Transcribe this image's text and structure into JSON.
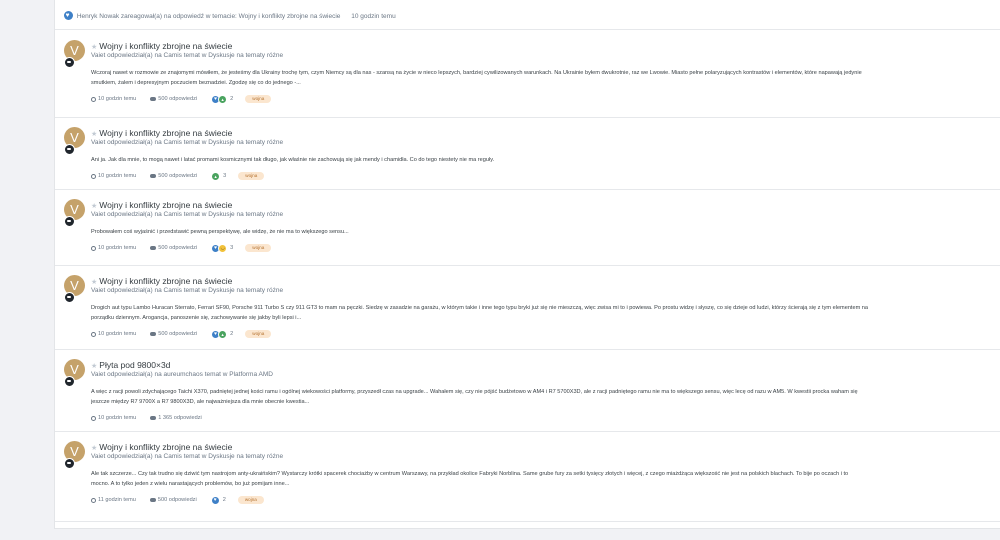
{
  "notification": {
    "text": "Henryk Nowak zareagował(a) na odpowiedź w temacie: Wojny i konflikty zbrojne na świecie",
    "time": "10 godzin temu"
  },
  "items": [
    {
      "avatar_letter": "V",
      "title": "Wojny i konflikty zbrojne na świecie",
      "sub": "Vaiet odpowiedział(a) na Camis temat w Dyskusje na tematy różne",
      "excerpt_1": "Wczoraj nawet w rozmowie ze znajomymi mówiłem, że jesteśmy dla Ukrainy trochę tym, czym Niemcy są dla nas - szansą na życie w nieco lepszych, bardziej cywilizowanych warunkach. Na Ukrainie byłem dwukrotnie, raz we Lwowie. Miasto pełne polaryzujących kontrastów i elementów, które napawają jedynie",
      "excerpt_2": "smutkiem, żalem i depresyjnym poczuciem beznadziei. Zgodzę się co do jednego -...",
      "time": "10 godzin temu",
      "replies": "500 odpowiedzi",
      "reactions": [
        "heart",
        "up"
      ],
      "reaction_count": "2",
      "tag": "wojna"
    },
    {
      "avatar_letter": "V",
      "title": "Wojny i konflikty zbrojne na świecie",
      "sub": "Vaiet odpowiedział(a) na Camis temat w Dyskusje na tematy różne",
      "excerpt_1": "Ani ja. Jak dla mnie, to mogą nawet i latać promami kosmicznymi tak długo, jak właśnie nie zachowują się jak mendy i chamidła. Co do tego niestety nie ma reguły.",
      "excerpt_2": "",
      "time": "10 godzin temu",
      "replies": "500 odpowiedzi",
      "reactions": [
        "up"
      ],
      "reaction_count": "3",
      "tag": "wojna"
    },
    {
      "avatar_letter": "V",
      "title": "Wojny i konflikty zbrojne na świecie",
      "sub": "Vaiet odpowiedział(a) na Camis temat w Dyskusje na tematy różne",
      "excerpt_1": "Probowałem coś wyjaśnić i przedstawić pewną perspektywę, ale widzę, że nie ma to większego sensu...",
      "excerpt_2": "",
      "time": "10 godzin temu",
      "replies": "500 odpowiedzi",
      "reactions": [
        "heart",
        "haha"
      ],
      "reaction_count": "3",
      "tag": "wojna"
    },
    {
      "avatar_letter": "V",
      "title": "Wojny i konflikty zbrojne na świecie",
      "sub": "Vaiet odpowiedział(a) na Camis temat w Dyskusje na tematy różne",
      "excerpt_1": "Drogich aut typu Lambo Huracan Sterrato, Ferrari SF90, Porsche 911 Turbo S czy 911 GT3 to mam na pęczki. Siedzę w zasadzie na garażu, w którym takie i inne tego typu bryki już się nie mieszczą, więc zwisa mi to i powiewa. Po prostu widzę i słyszę, co się dzieje od ludzi, którzy ścierają się z tym elementem na",
      "excerpt_2": "porządku dziennym. Arogancja, panoszenie się, zachowywanie się jakby byli lepsi i...",
      "time": "10 godzin temu",
      "replies": "500 odpowiedzi",
      "reactions": [
        "heart",
        "up"
      ],
      "reaction_count": "2",
      "tag": "wojna"
    },
    {
      "avatar_letter": "V",
      "title": "Płyta pod 9800×3d",
      "sub": "Vaiet odpowiedział(a) na aureumchaos temat w Platforma AMD",
      "excerpt_1": "A więc z racji powoli zdychającego Taichi X370, padniętej jednej kości ramu i ogólnej wiekowości platformy, przyszedł czas na upgrade... Wahałem się, czy nie pójść budżetowo w AM4 i R7 5700X3D, ale z racji padniętego ramu nie ma to większego sensu, więc lecę od razu w AM5. W kwestii procka waham się",
      "excerpt_2": "jeszcze między R7 9700X a R7 9800X3D, ale najważniejsza dla mnie obecnie kwestia...",
      "time": "10 godzin temu",
      "replies": "1 365 odpowiedzi",
      "reactions": [],
      "reaction_count": "",
      "tag": ""
    },
    {
      "avatar_letter": "V",
      "title": "Wojny i konflikty zbrojne na świecie",
      "sub": "Vaiet odpowiedział(a) na Camis temat w Dyskusje na tematy różne",
      "excerpt_1": "Ale tak szczerze... Czy tak trudno się dziwić tym nastrojom anty-ukraińskim? Wystarczy krótki spacerek chociażby w centrum Warszawy, na przykład okolice Fabryki Norblina. Same grube fury za setki tysięcy złotych i więcej, z czego miażdżąca większość nie jest na polskich blachach. To bije po oczach i to",
      "excerpt_2": "mocno. A to tylko jeden z wielu narastających problemów, bo już pomijam inne...",
      "time": "11 godzin temu",
      "replies": "500 odpowiedzi",
      "reactions": [
        "heart"
      ],
      "reaction_count": "2",
      "tag": "wojna"
    }
  ]
}
